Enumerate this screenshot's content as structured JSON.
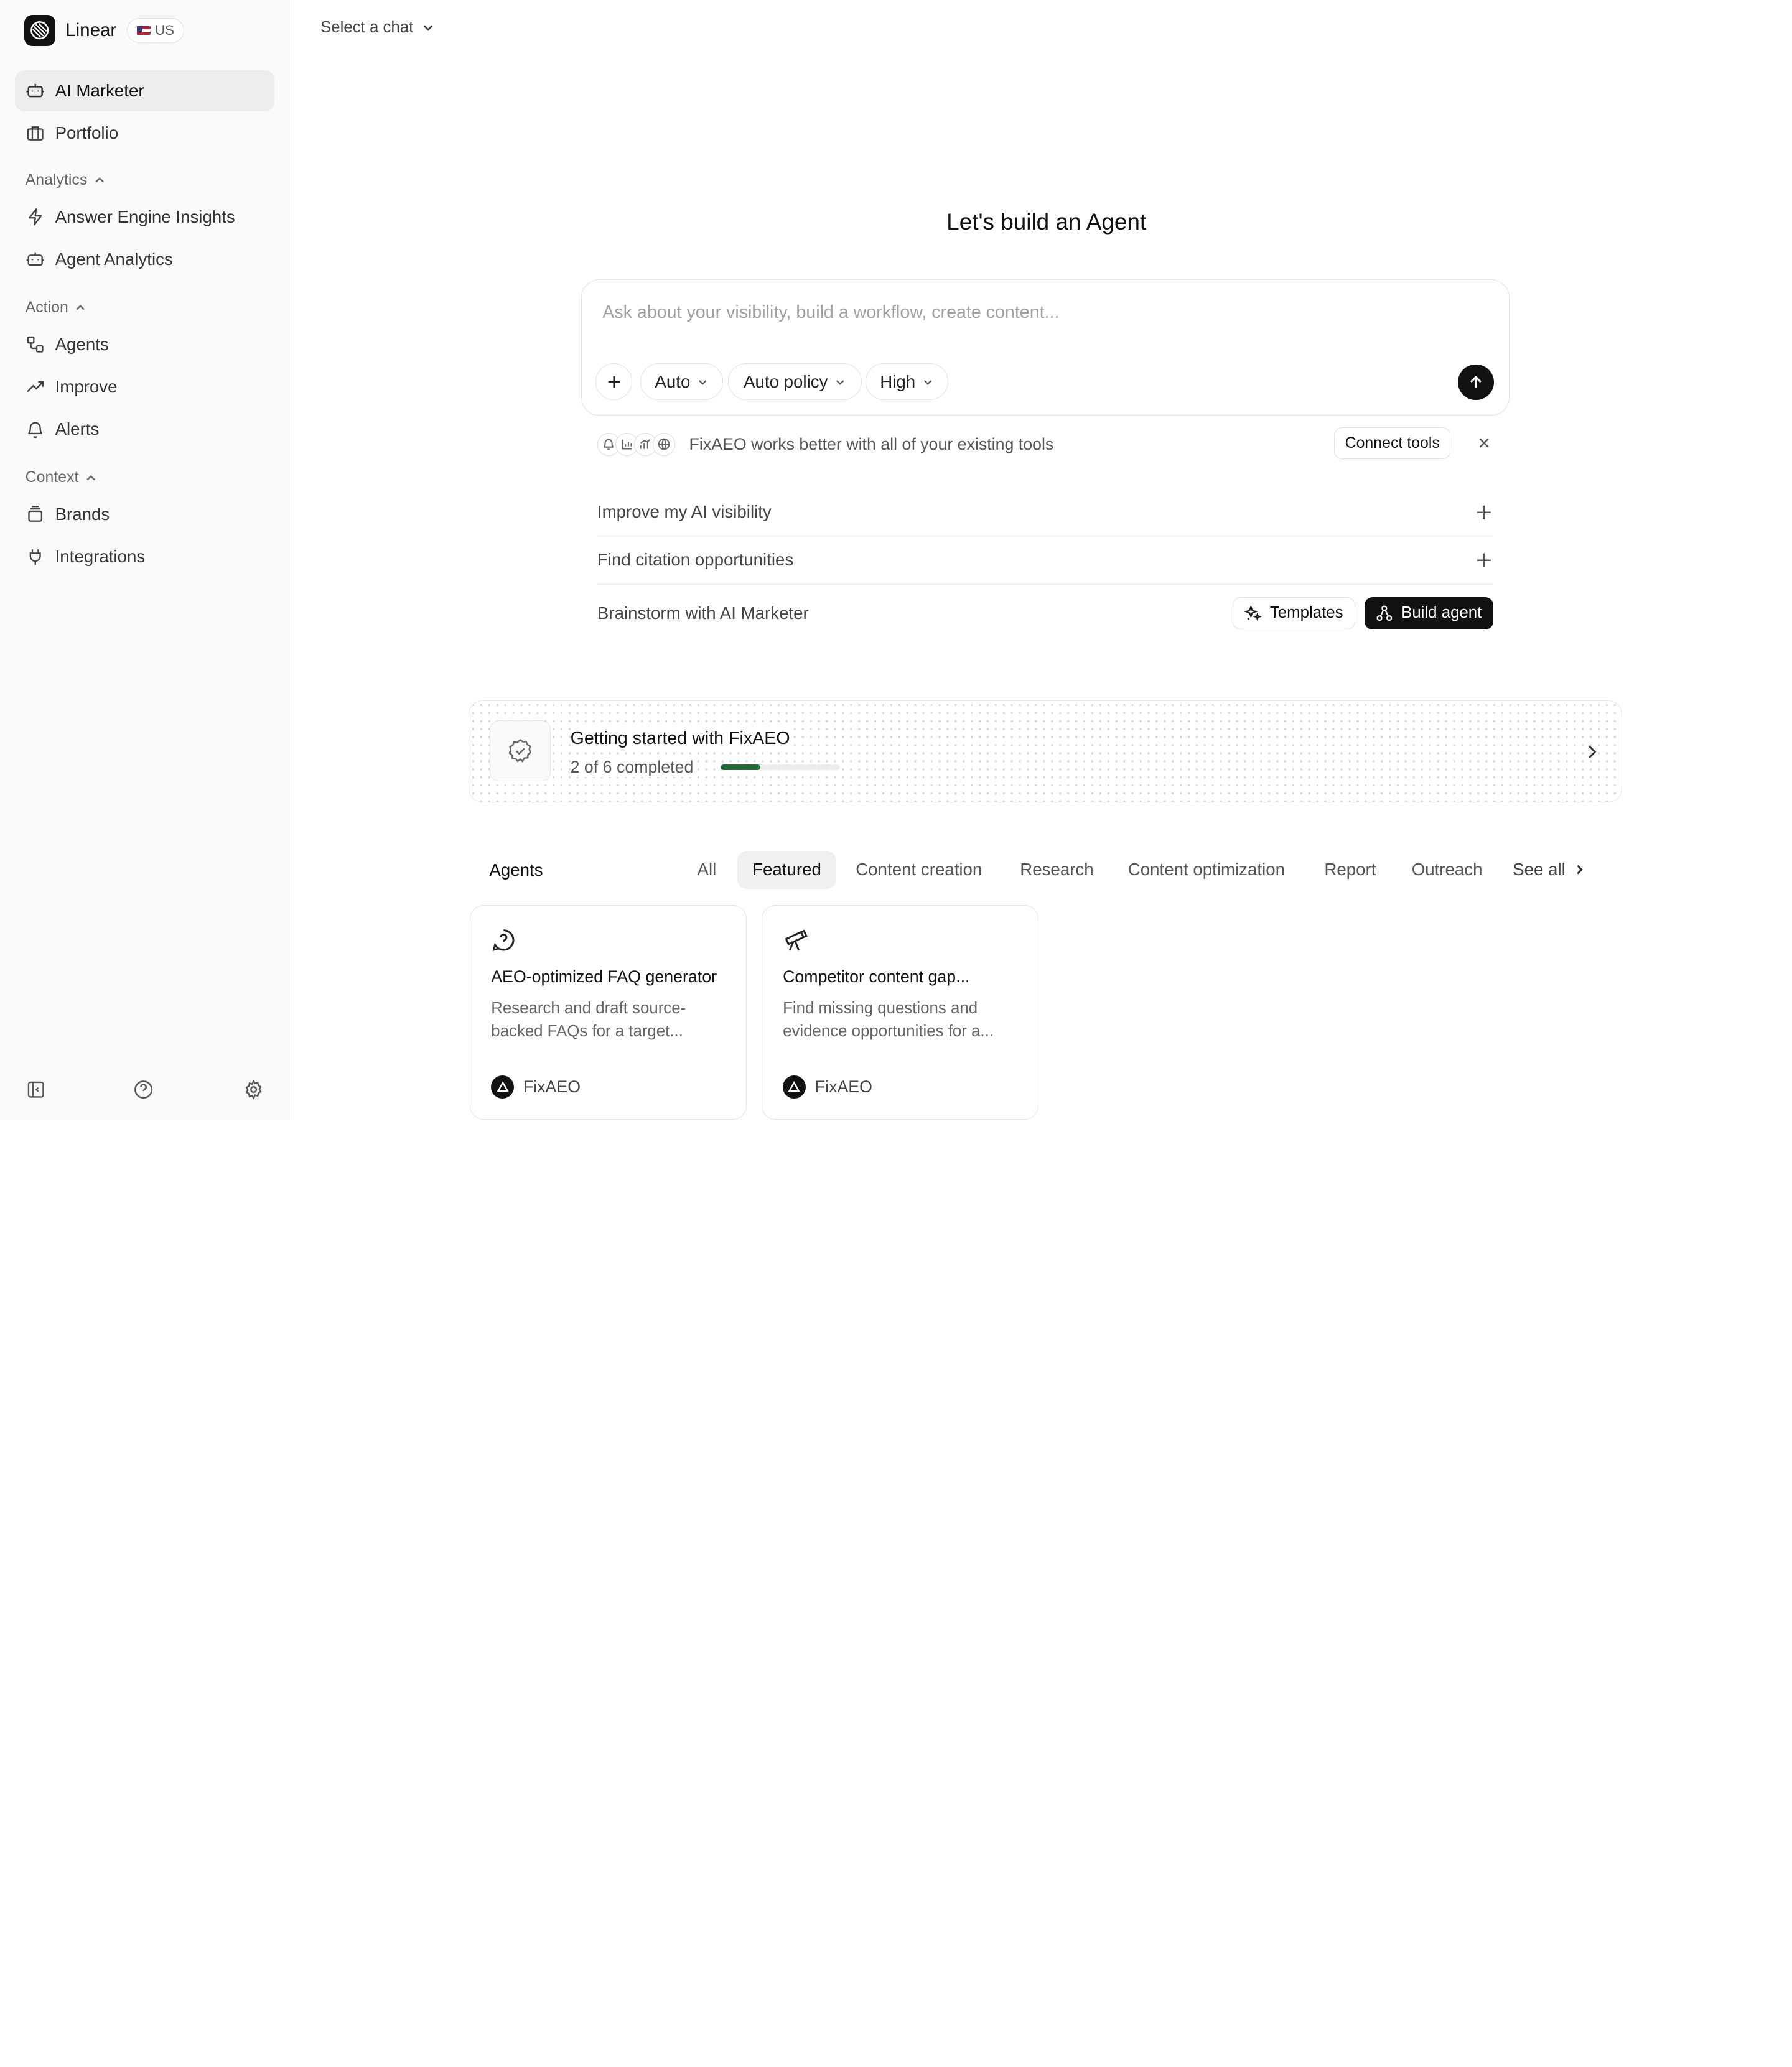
{
  "sidebar": {
    "brand_name": "Linear",
    "region": "US",
    "items_top": [
      {
        "label": "AI Marketer",
        "icon": "bot-icon",
        "active": true
      },
      {
        "label": "Portfolio",
        "icon": "briefcase-icon"
      }
    ],
    "sections": [
      {
        "title": "Analytics",
        "items": [
          {
            "label": "Answer Engine Insights",
            "icon": "zap-icon"
          },
          {
            "label": "Agent Analytics",
            "icon": "bot-icon"
          }
        ]
      },
      {
        "title": "Action",
        "items": [
          {
            "label": "Agents",
            "icon": "workflow-icon"
          },
          {
            "label": "Improve",
            "icon": "trending-up-icon"
          },
          {
            "label": "Alerts",
            "icon": "bell-icon"
          }
        ]
      },
      {
        "title": "Context",
        "items": [
          {
            "label": "Brands",
            "icon": "layers-icon"
          },
          {
            "label": "Integrations",
            "icon": "plug-icon"
          }
        ]
      }
    ],
    "bottom_icons": [
      "sidebar-toggle-icon",
      "help-icon",
      "settings-icon"
    ]
  },
  "header": {
    "chat_select": "Select a chat"
  },
  "composer": {
    "headline": "Let's build an Agent",
    "placeholder": "Ask about your visibility, build a workflow, create content...",
    "pills": [
      "Auto",
      "Auto policy",
      "High"
    ]
  },
  "tools": {
    "text": "FixAEO works better with all of your existing tools",
    "connect_label": "Connect tools"
  },
  "suggestions": [
    "Improve my AI visibility",
    "Find citation opportunities"
  ],
  "brainstorm": {
    "label": "Brainstorm with AI Marketer",
    "templates_label": "Templates",
    "build_label": "Build agent"
  },
  "getting_started": {
    "title": "Getting started with FixAEO",
    "progress_text": "2 of 6 completed",
    "completed": 2,
    "total": 6
  },
  "agents": {
    "title": "Agents",
    "tabs": [
      "All",
      "Featured",
      "Content creation",
      "Research",
      "Content optimization",
      "Report",
      "Outreach"
    ],
    "active_tab": "Featured",
    "see_all": "See all",
    "cards": [
      {
        "icon": "question-circle-icon",
        "title": "AEO-optimized FAQ generator",
        "desc": "Research and draft source-backed FAQs for a target...",
        "author": "FixAEO"
      },
      {
        "icon": "telescope-icon",
        "title": "Competitor content gap...",
        "desc": "Find missing questions and evidence opportunities for a...",
        "author": "FixAEO"
      }
    ]
  },
  "colors": {
    "accent": "#111111",
    "progress": "#1f6b3a",
    "active_bg": "#ededed"
  }
}
